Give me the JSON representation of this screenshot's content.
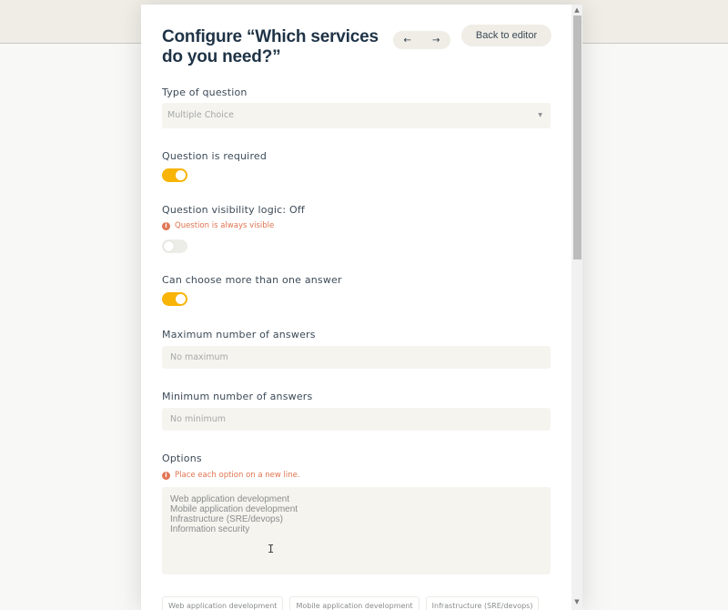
{
  "header": {
    "title": "Configure “Which services do you need?”",
    "prev_icon": "←",
    "next_icon": "→",
    "back_label": "Back to editor"
  },
  "type_of_question": {
    "label": "Type of question",
    "value": "Multiple Choice",
    "caret": "▼"
  },
  "required": {
    "label": "Question is required",
    "enabled": true
  },
  "visibility": {
    "label": "Question visibility logic: Off",
    "hint": "Question is always visible",
    "hint_icon": "i",
    "enabled": false
  },
  "multiple_answers": {
    "label": "Can choose more than one answer",
    "enabled": true
  },
  "max_answers": {
    "label": "Maximum number of answers",
    "placeholder": "No maximum"
  },
  "min_answers": {
    "label": "Minimum number of answers",
    "placeholder": "No minimum"
  },
  "options": {
    "label": "Options",
    "hint": "Place each option on a new line.",
    "hint_icon": "i",
    "value": "Web application development\nMobile application development\nInfrastructure (SRE/devops)\nInformation security",
    "chips": [
      "Web application development",
      "Mobile application development",
      "Infrastructure (SRE/devops)"
    ]
  },
  "scrollbar": {
    "up_icon": "▲",
    "down_icon": "▼"
  },
  "colors": {
    "accent": "#f8b407",
    "hint": "#e0744f",
    "field_bg": "#f5f4ef",
    "title": "#1f3346"
  }
}
